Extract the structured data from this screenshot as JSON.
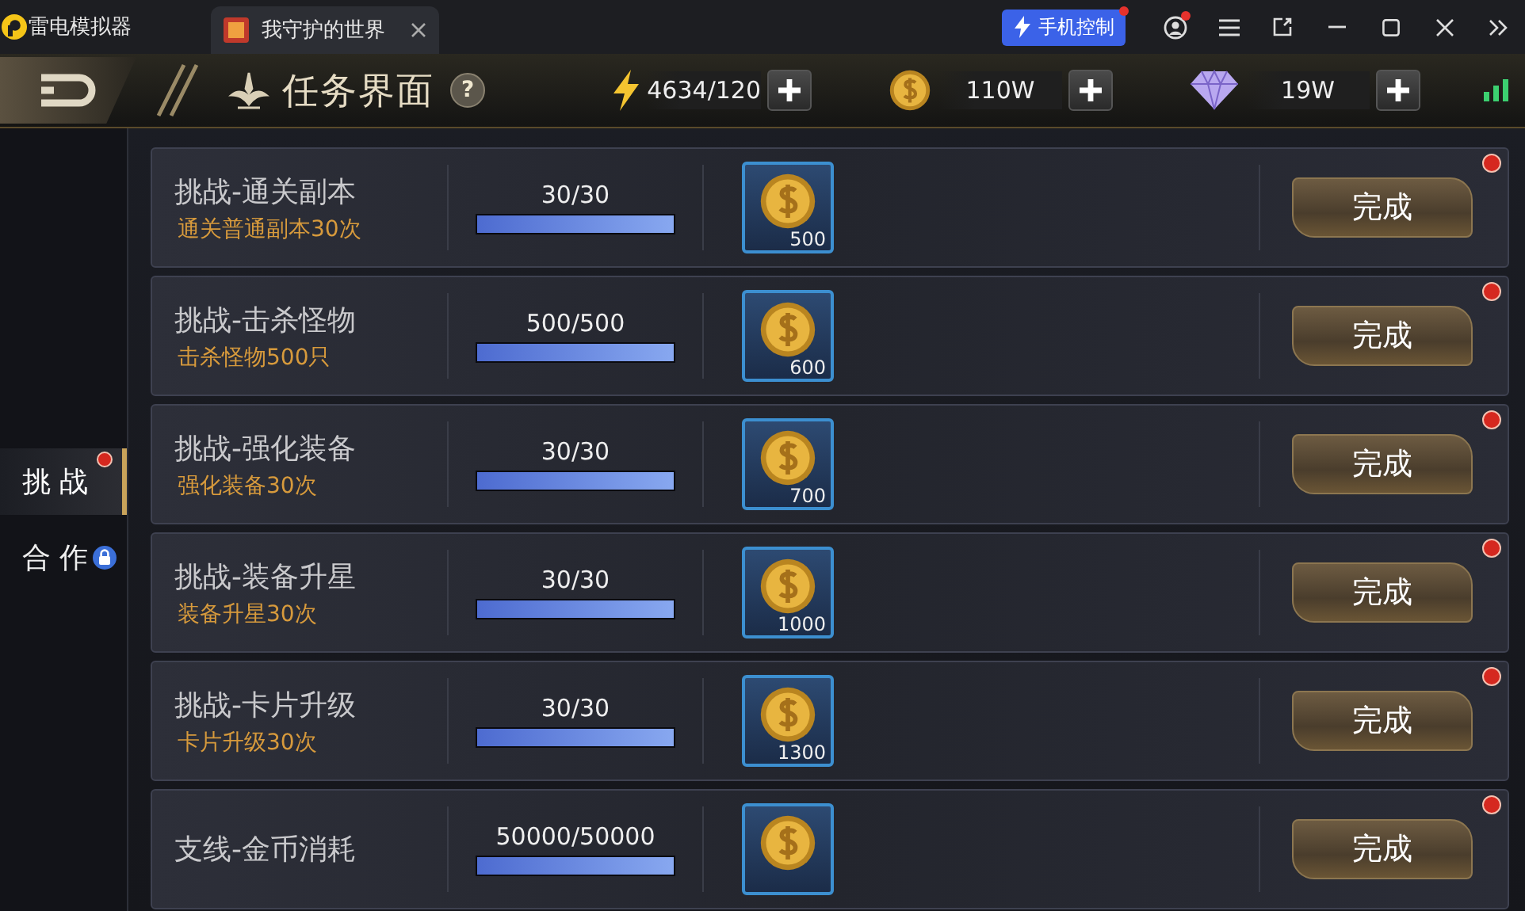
{
  "emulator": {
    "app_name": "雷电模拟器",
    "tab_title": "我守护的世界",
    "control_button": "手机控制",
    "control_notice": true,
    "account_notice": true
  },
  "header": {
    "title": "任务界面",
    "help": "?",
    "energy": "4634/120",
    "gold": "110W",
    "diamonds": "19W"
  },
  "sidebar": [
    {
      "label": "挑 战",
      "selected": true,
      "notice": true,
      "locked": false
    },
    {
      "label": "合 作",
      "selected": false,
      "notice": false,
      "locked": true
    }
  ],
  "tasks": [
    {
      "title": "挑战-通关副本",
      "description": "通关普通副本30次",
      "progress": "30/30",
      "level": 1,
      "reward": "500",
      "button": "完成",
      "notice": true
    },
    {
      "title": "挑战-击杀怪物",
      "description": "击杀怪物500只",
      "progress": "500/500",
      "level": 1,
      "reward": "600",
      "button": "完成",
      "notice": true
    },
    {
      "title": "挑战-强化装备",
      "description": "强化装备30次",
      "progress": "30/30",
      "level": 1,
      "reward": "700",
      "button": "完成",
      "notice": true
    },
    {
      "title": "挑战-装备升星",
      "description": "装备升星30次",
      "progress": "30/30",
      "level": 1,
      "reward": "1000",
      "button": "完成",
      "notice": true
    },
    {
      "title": "挑战-卡片升级",
      "description": "卡片升级30次",
      "progress": "30/30",
      "level": 1,
      "reward": "1300",
      "button": "完成",
      "notice": true
    },
    {
      "title": "支线-金币消耗",
      "progress": "50000/50000",
      "level": 1,
      "button": "完成",
      "notice": true
    }
  ]
}
